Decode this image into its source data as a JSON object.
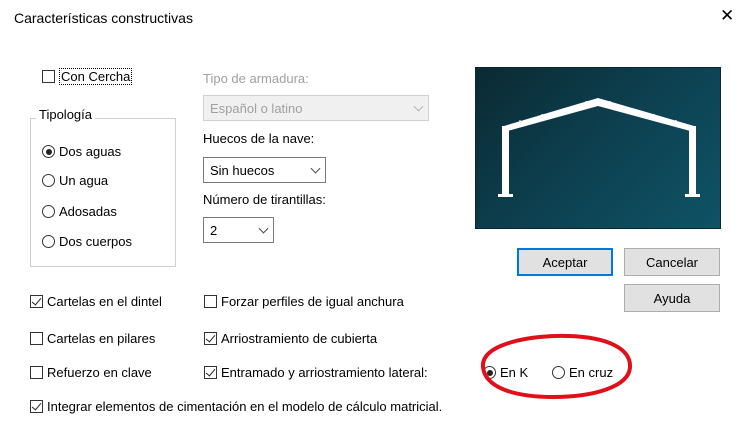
{
  "window": {
    "title": "Características constructivas",
    "close_symbol": "✕"
  },
  "con_cercha": {
    "label": "Con Cercha",
    "checked": false
  },
  "tipologia": {
    "label": "Tipología",
    "options": [
      {
        "label": "Dos aguas",
        "checked": true
      },
      {
        "label": "Un agua",
        "checked": false
      },
      {
        "label": "Adosadas",
        "checked": false
      },
      {
        "label": "Dos cuerpos",
        "checked": false
      }
    ]
  },
  "tipo_armadura": {
    "label": "Tipo de armadura:",
    "value": "Español o latino",
    "enabled": false
  },
  "huecos_nave": {
    "label": "Huecos de la nave:",
    "value": "Sin huecos"
  },
  "numero_tirantillas": {
    "label": "Número de tirantillas:",
    "value": "2"
  },
  "buttons": {
    "accept": "Aceptar",
    "cancel": "Cancelar",
    "help": "Ayuda"
  },
  "options": {
    "cartelas_dintel": {
      "label": "Cartelas en el dintel",
      "checked": true
    },
    "cartelas_pilares": {
      "label": "Cartelas en pilares",
      "checked": false
    },
    "refuerzo_clave": {
      "label": "Refuerzo en clave",
      "checked": false
    },
    "forzar_perfiles": {
      "label": "Forzar perfiles de igual anchura",
      "checked": false
    },
    "arriostramiento_cubierta": {
      "label": "Arriostramiento de cubierta",
      "checked": true
    },
    "entramado": {
      "label": "Entramado y arriostramiento lateral:",
      "checked": true
    },
    "integrar_cimentacion": {
      "label": "Integrar elementos de cimentación en el modelo de cálculo matricial.",
      "checked": true
    }
  },
  "arriostramiento_tipo": {
    "en_k": {
      "label": "En K",
      "checked": true
    },
    "en_cruz": {
      "label": "En cruz",
      "checked": false
    }
  },
  "colors": {
    "annotation": "#e0101a",
    "default_button_border": "#0078d7",
    "preview_bg": "#0d4050"
  },
  "icons": {
    "close": "close-icon",
    "preview": "portal-frame-preview"
  }
}
